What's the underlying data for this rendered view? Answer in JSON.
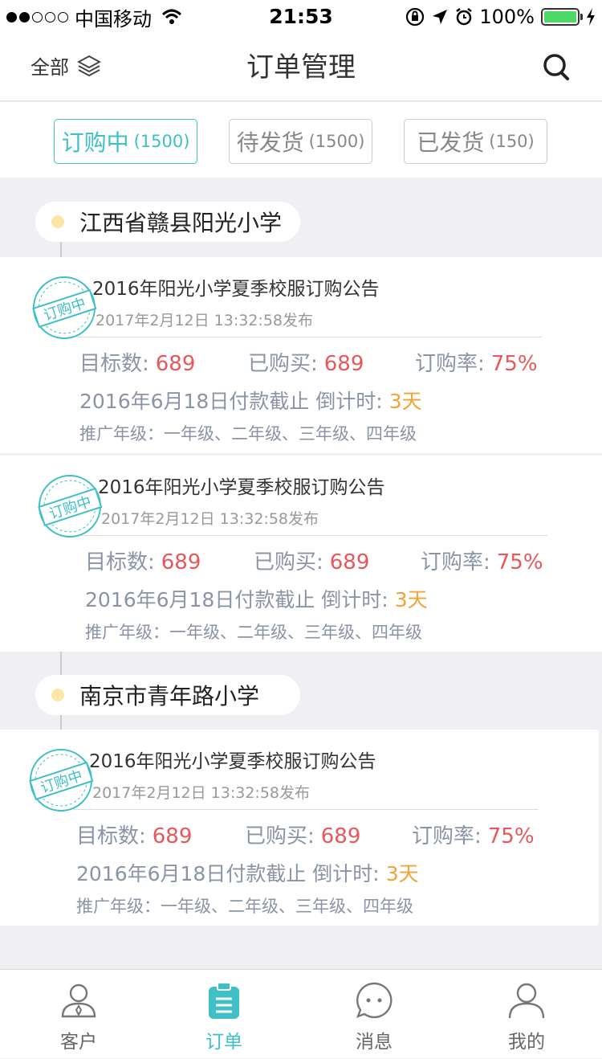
{
  "status_bar": {
    "carrier": "中国移动",
    "time": "21:53",
    "battery": "100%"
  },
  "nav": {
    "left_label": "全部",
    "title": "订单管理"
  },
  "filters": [
    {
      "label": "订购中",
      "count": "(1500)",
      "active": true
    },
    {
      "label": "待发货",
      "count": "(1500)",
      "active": false
    },
    {
      "label": "已发货",
      "count": "(150)",
      "active": false
    }
  ],
  "groups": [
    {
      "school": "江西省赣县阳光小学",
      "orders": [
        {
          "stamp": "订购中",
          "title": "2016年阳光小学夏季校服订购公告",
          "date": "2017年2月12日 13:32:58发布",
          "target_label": "目标数:",
          "target": "689",
          "bought_label": "已购买:",
          "bought": "689",
          "rate_label": "订购率:",
          "rate": "75%",
          "deadline": "2016年6月18日付款截止 倒计时:",
          "countdown": "3天",
          "grades": "推广年级：一年级、二年级、三年级、四年级"
        },
        {
          "stamp": "订购中",
          "title": "2016年阳光小学夏季校服订购公告",
          "date": "2017年2月12日 13:32:58发布",
          "target_label": "目标数:",
          "target": "689",
          "bought_label": "已购买:",
          "bought": "689",
          "rate_label": "订购率:",
          "rate": "75%",
          "deadline": "2016年6月18日付款截止 倒计时:",
          "countdown": "3天",
          "grades": "推广年级：一年级、二年级、三年级、四年级"
        }
      ]
    },
    {
      "school": "南京市青年路小学",
      "orders": [
        {
          "stamp": "订购中",
          "title": "2016年阳光小学夏季校服订购公告",
          "date": "2017年2月12日 13:32:58发布",
          "target_label": "目标数:",
          "target": "689",
          "bought_label": "已购买:",
          "bought": "689",
          "rate_label": "订购率:",
          "rate": "75%",
          "deadline": "2016年6月18日付款截止 倒计时:",
          "countdown": "3天",
          "grades": "推广年级：一年级、二年级、三年级、四年级"
        }
      ]
    }
  ],
  "tabbar": [
    {
      "label": "客户",
      "icon": "customer-icon",
      "active": false
    },
    {
      "label": "订单",
      "icon": "order-icon",
      "active": true
    },
    {
      "label": "消息",
      "icon": "message-icon",
      "active": false
    },
    {
      "label": "我的",
      "icon": "profile-icon",
      "active": false
    }
  ],
  "colors": {
    "accent": "#3fc0c7",
    "value_red": "#e8575a",
    "countdown_orange": "#f0a436",
    "muted": "#8a94a6"
  }
}
